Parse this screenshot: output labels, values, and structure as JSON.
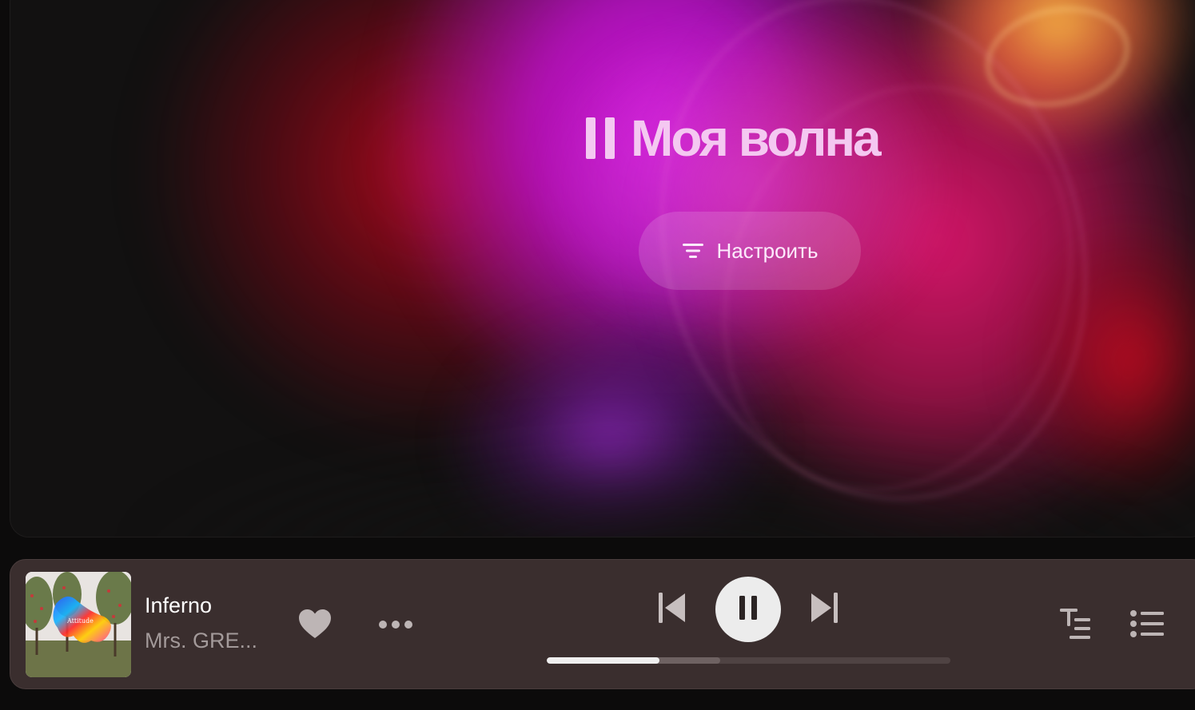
{
  "hero": {
    "title": "Моя волна",
    "tune_button_label": "Настроить",
    "icons": [
      "pause-icon",
      "tune-icon"
    ]
  },
  "player": {
    "track": {
      "title": "Inferno",
      "artist": "Mrs. GRE..."
    },
    "cover": {
      "album_text": "Attitude"
    },
    "state": "playing",
    "progress": {
      "played": 0.28,
      "buffered": 0.43
    },
    "icons": [
      "heart-icon",
      "more-icon",
      "previous-icon",
      "pause-icon",
      "next-icon",
      "lyrics-icon",
      "queue-icon"
    ]
  },
  "colors": {
    "background": "#0c0b0b",
    "hero_title": "#f4c8f1",
    "player_bg": "#3a2e2e",
    "progress_fill": "#efefef",
    "progress_track": "#4f4343",
    "secondary_text": "#a39a9a"
  }
}
